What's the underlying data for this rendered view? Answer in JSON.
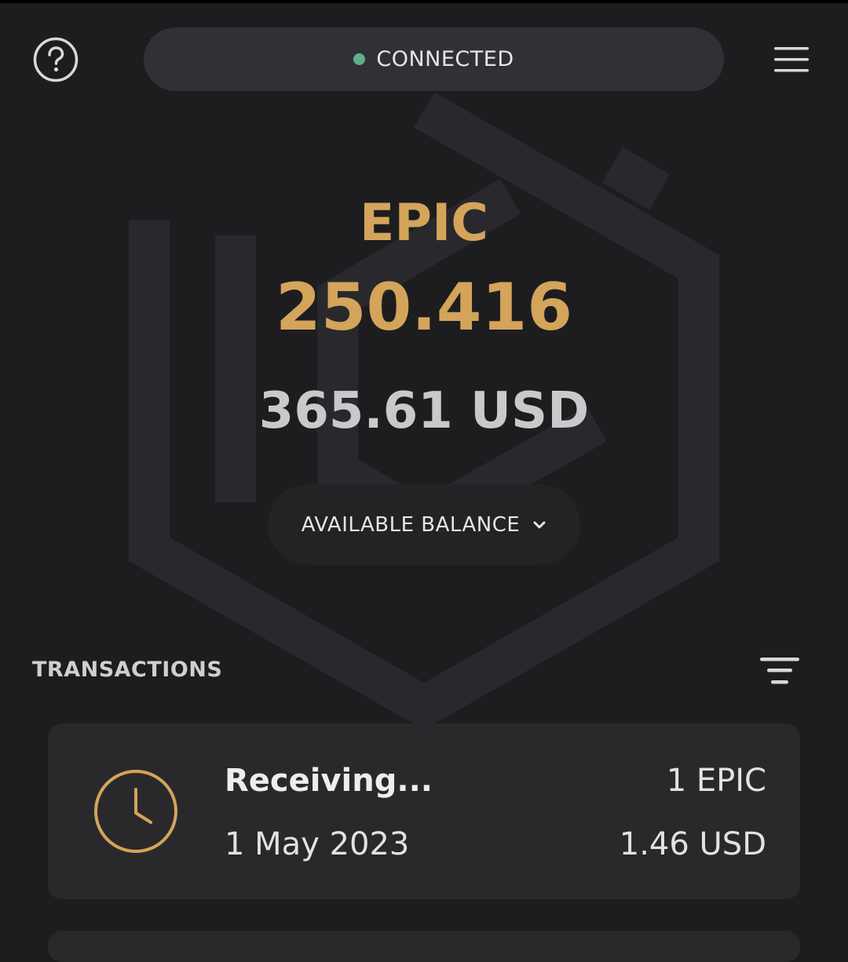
{
  "header": {
    "status_text": "CONNECTED",
    "status_color": "#5fb08a",
    "help_icon": "question-circle-icon",
    "menu_icon": "hamburger-menu-icon"
  },
  "balance": {
    "coin": "EPIC",
    "amount": "250.416",
    "fiat": "365.61 USD",
    "selector_label": "AVAILABLE BALANCE",
    "selector_icon": "chevron-down-icon",
    "accent_color": "#d4a45a"
  },
  "transactions": {
    "title": "TRANSACTIONS",
    "filter_icon": "filter-icon",
    "items": [
      {
        "status": "Receiving...",
        "date": "1 May 2023",
        "amount": "1 EPIC",
        "fiat": "1.46 USD",
        "icon": "clock-icon"
      }
    ]
  }
}
